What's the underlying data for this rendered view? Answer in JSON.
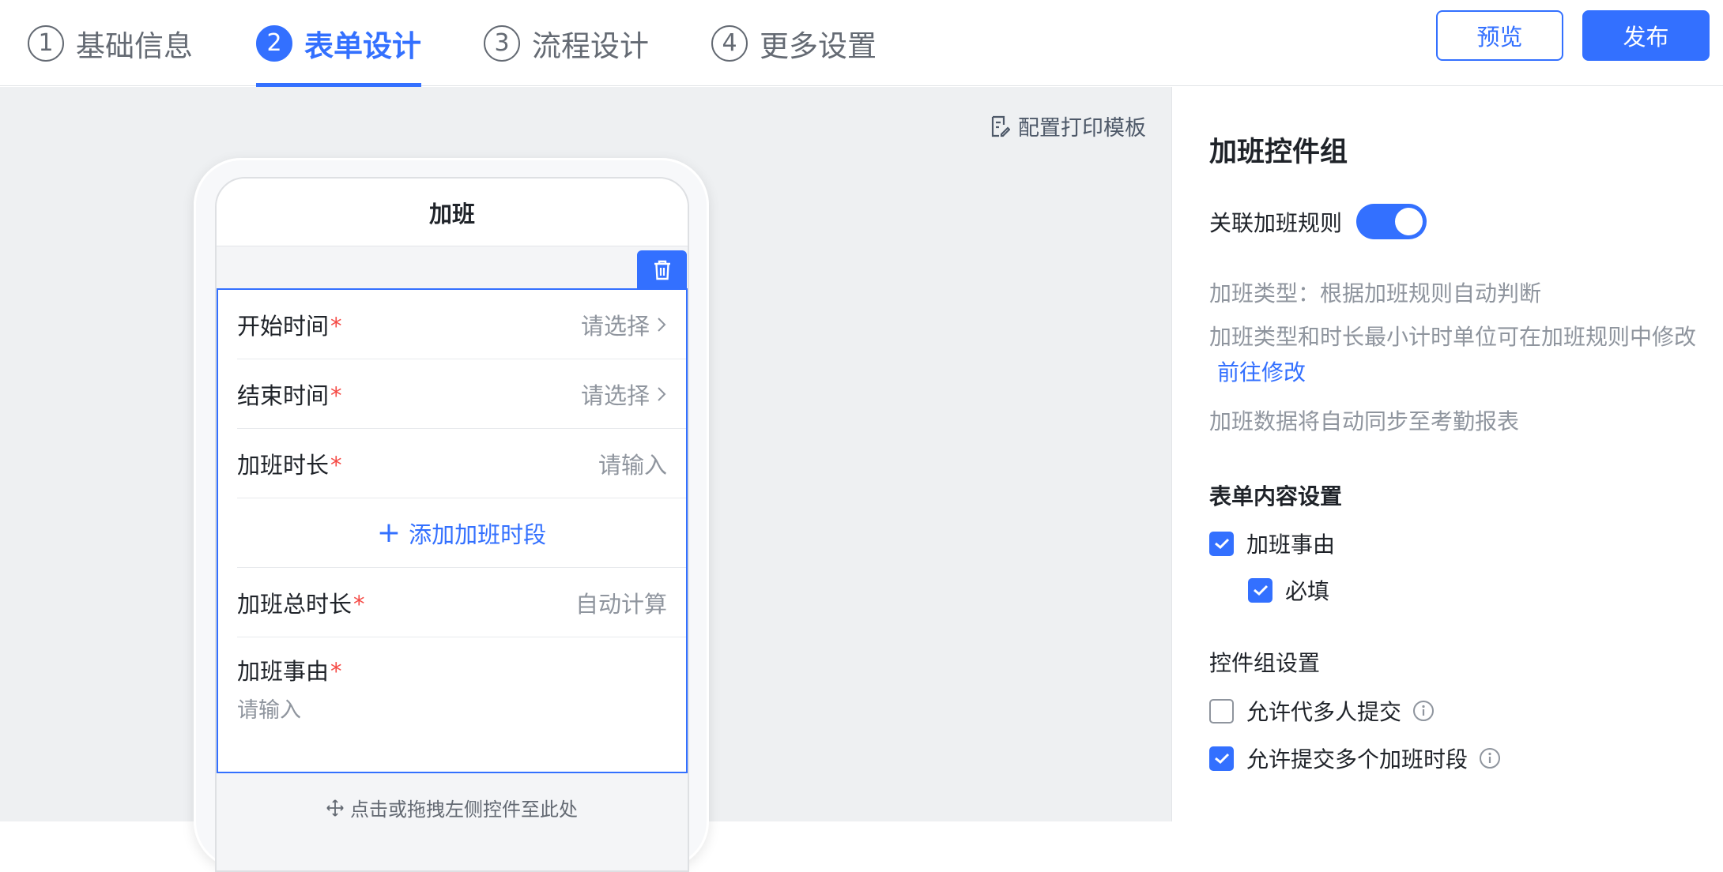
{
  "steps": [
    {
      "num": "1",
      "label": "基础信息",
      "active": false
    },
    {
      "num": "2",
      "label": "表单设计",
      "active": true
    },
    {
      "num": "3",
      "label": "流程设计",
      "active": false
    },
    {
      "num": "4",
      "label": "更多设置",
      "active": false
    }
  ],
  "header_buttons": {
    "preview": "预览",
    "publish": "发布"
  },
  "canvas": {
    "print_template": "配置打印模板",
    "phone": {
      "title": "加班",
      "fields": [
        {
          "label": "开始时间",
          "required": "*",
          "value": "请选择",
          "icon": "chevron-right-icon"
        },
        {
          "label": "结束时间",
          "required": "*",
          "value": "请选择",
          "icon": "chevron-right-icon"
        },
        {
          "label": "加班时长",
          "required": "*",
          "value": "请输入"
        }
      ],
      "add_segment": {
        "icon": "+",
        "label": "添加加班时段"
      },
      "total_duration": {
        "label": "加班总时长",
        "required": "*",
        "value": "自动计算"
      },
      "reason": {
        "label": "加班事由",
        "required": "*",
        "placeholder": "请输入"
      },
      "drop_hint": "点击或拖拽左侧控件至此处"
    }
  },
  "panel": {
    "title": "加班控件组",
    "link_rule": {
      "label": "关联加班规则",
      "on": true
    },
    "desc_type": "加班类型：根据加班规则自动判断",
    "desc_modify": "加班类型和时长最小计时单位可在加班规则中修改",
    "goto_modify": "前往修改",
    "desc_sync": "加班数据将自动同步至考勤报表",
    "form_content": {
      "title": "表单内容设置",
      "reason": {
        "label": "加班事由",
        "checked": true
      },
      "required": {
        "label": "必填",
        "checked": true
      }
    },
    "group_settings": {
      "title": "控件组设置",
      "allow_multi_person": {
        "label": "允许代多人提交",
        "checked": false
      },
      "allow_multi_segment": {
        "label": "允许提交多个加班时段",
        "checked": true
      }
    }
  },
  "colors": {
    "accent": "#3370ff",
    "required": "#f54a45",
    "muted": "#8f959e"
  }
}
